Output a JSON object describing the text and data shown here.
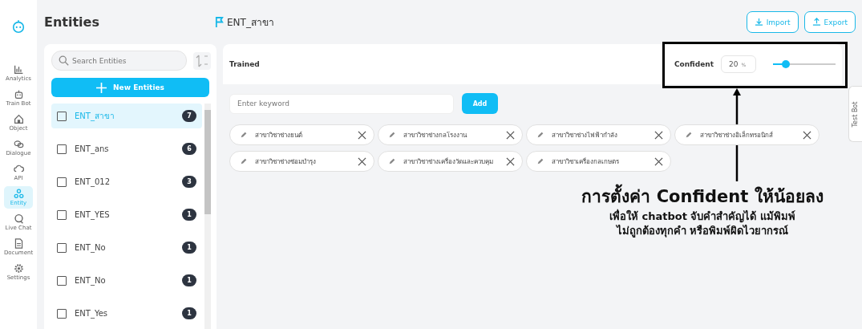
{
  "nav": [
    {
      "label": "Analytics",
      "selected": false
    },
    {
      "label": "Train Bot",
      "selected": false
    },
    {
      "label": "Object",
      "selected": false
    },
    {
      "label": "Dialogue",
      "selected": false
    },
    {
      "label": "API",
      "selected": false
    },
    {
      "label": "Entity",
      "selected": true
    },
    {
      "label": "Live Chat",
      "selected": false
    },
    {
      "label": "Document",
      "selected": false
    },
    {
      "label": "Settings",
      "selected": false
    }
  ],
  "entities": {
    "title": "Entities",
    "search_placeholder": "Search Entities",
    "new_button": "New Entities",
    "items": [
      {
        "name": "ENT_สาขา",
        "count": "7",
        "selected": true,
        "checked": false
      },
      {
        "name": "ENT_ans",
        "count": "6",
        "selected": false,
        "checked": false
      },
      {
        "name": "ENT_012",
        "count": "3",
        "selected": false,
        "checked": false
      },
      {
        "name": "ENT_YES",
        "count": "1",
        "selected": false,
        "checked": false
      },
      {
        "name": "ENT_No",
        "count": "1",
        "selected": false,
        "checked": false
      },
      {
        "name": "ENT_No",
        "count": "1",
        "selected": false,
        "checked": false
      },
      {
        "name": "ENT_Yes",
        "count": "1",
        "selected": false,
        "checked": false
      }
    ]
  },
  "detail": {
    "title": "ENT_สาขา",
    "import_button": "Import",
    "export_button": "Export",
    "status": "Trained",
    "confident_label": "Confident",
    "confident_value": "20",
    "confident_unit": "%",
    "level": 0.2,
    "keyword_placeholder": "Enter keyword",
    "add_button": "Add",
    "keywords": [
      "สาขาวิชาช่างยนต์",
      "สาขาวิชาช่างกลโรงงาน",
      "สาขาวิชาช่างไฟฟ้ากำลัง",
      "สาขาวิชาช่างอิเล็กทรอนิกส์",
      "สาขาวิชาช่างซ่อมบำรุง",
      "สาขาวิชาช่างเครื่องวัดและควบคุม",
      "สาขาวิชาเครื่องกลเกษตร"
    ]
  },
  "test_bot": "Test Bot",
  "annotation": {
    "heading": "การตั้งค่า Confident ให้น้อยลง",
    "lines": [
      "เพื่อให้ chatbot จับคำสำคัญได้ แม้พิมพ์",
      "ไม่ถูกต้องทุกคำ หรือพิมพ์ผิดไวยากรณ์"
    ]
  }
}
